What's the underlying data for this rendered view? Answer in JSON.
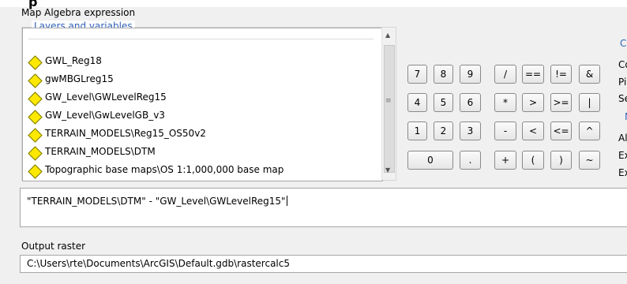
{
  "header_label": "Map Algebra expression",
  "layers": {
    "title": "Layers and variables",
    "items": [
      {
        "label": "GWL_Reg18"
      },
      {
        "label": "gwMBGLreg15"
      },
      {
        "label": "GW_Level\\GWLevelReg15"
      },
      {
        "label": "GW_Level\\GwLevelGB_v3"
      },
      {
        "label": "TERRAIN_MODELS\\Reg15_OS50v2"
      },
      {
        "label": "TERRAIN_MODELS\\DTM"
      },
      {
        "label": "Topographic base maps\\OS 1:1,000,000 base map"
      }
    ]
  },
  "calculator": {
    "buttons": [
      "7",
      "8",
      "9",
      "/",
      "==",
      "!=",
      "&",
      "4",
      "5",
      "6",
      "*",
      ">",
      ">=",
      "|",
      "1",
      "2",
      "3",
      "-",
      "<",
      "<=",
      "^",
      "0",
      ".",
      "+",
      "(",
      ")",
      "~"
    ]
  },
  "right_panel": {
    "header": "C",
    "items": [
      "Co",
      "Pi",
      "Se",
      "N",
      "Al",
      "Ex",
      "Ex"
    ]
  },
  "expression": {
    "value": "\"TERRAIN_MODELS\\DTM\" - \"GW_Level\\GWLevelReg15\""
  },
  "output": {
    "label": "Output raster",
    "value": "C:\\Users\\rte\\Documents\\ArcGIS\\Default.gdb\\rastercalc5"
  },
  "colors": {
    "group_title": "#2f62b8",
    "layer_icon": "#ffe800"
  },
  "icons": {
    "layer": "diamond-layer-icon",
    "scroll_up": "scroll-up-arrow-icon",
    "scroll_down": "scroll-down-arrow-icon",
    "scroll_grip": "scroll-grip-icon"
  }
}
